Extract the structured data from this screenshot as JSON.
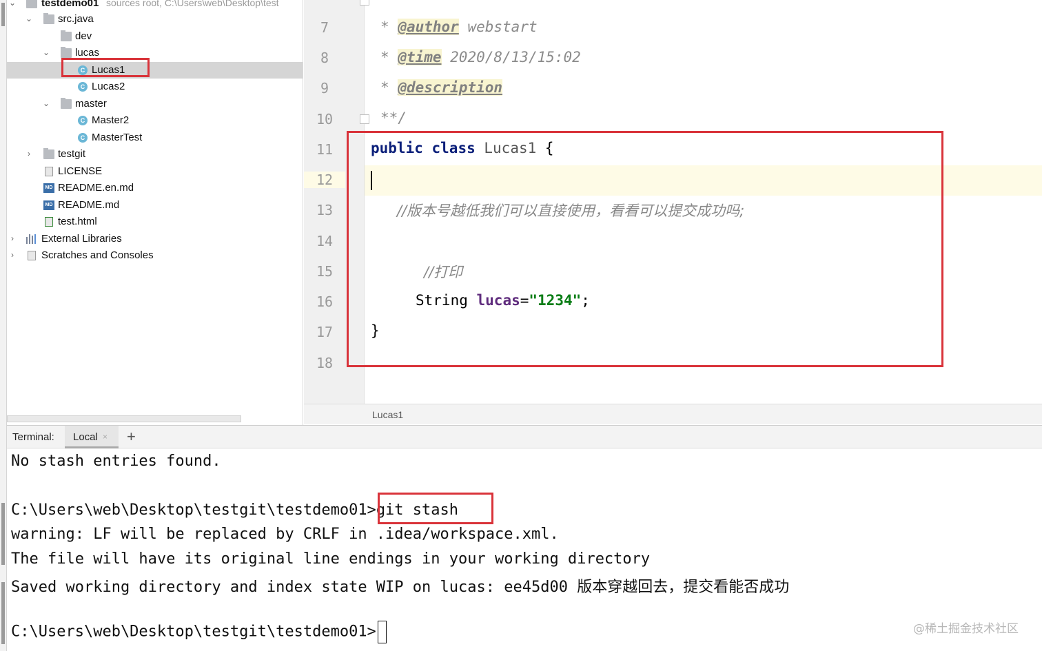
{
  "project_tree": {
    "root": {
      "name": "testdemo01",
      "path": "sources root,  C:\\Users\\web\\Desktop\\test"
    },
    "items": [
      {
        "label": "src.java"
      },
      {
        "label": "dev"
      },
      {
        "label": "lucas"
      },
      {
        "label": "Lucas1",
        "icon_letter": "C"
      },
      {
        "label": "Lucas2",
        "icon_letter": "C"
      },
      {
        "label": "master"
      },
      {
        "label": "Master2",
        "icon_letter": "C"
      },
      {
        "label": "MasterTest",
        "icon_letter": "C"
      },
      {
        "label": "testgit"
      },
      {
        "label": "LICENSE"
      },
      {
        "label": "README.en.md",
        "icon_text": "MD"
      },
      {
        "label": "README.md",
        "icon_text": "MD"
      },
      {
        "label": "test.html"
      },
      {
        "label": "External Libraries"
      },
      {
        "label": "Scratches and Consoles"
      }
    ],
    "selected": "Lucas1"
  },
  "editor": {
    "line_numbers": [
      "7",
      "8",
      "9",
      "10",
      "11",
      "12",
      "13",
      "14",
      "15",
      "16",
      "17",
      "18"
    ],
    "current_line": "12",
    "doc": {
      "author_prefix": "* ",
      "author_tag": "@author",
      "author_value": " webstart",
      "time_prefix": "* ",
      "time_tag": "@time",
      "time_value": " 2020/8/13/15:02",
      "desc_prefix": "* ",
      "desc_tag": "@description",
      "end": "**/"
    },
    "code": {
      "kw_public": "public",
      "kw_class": "class",
      "class_name": "Lucas1",
      "open_brace": "{",
      "comment1": "//版本号越低我们可以直接使用，看看可以提交成功吗;",
      "comment2": "//打印",
      "type": "String",
      "field": "lucas",
      "equals": "=",
      "string": "\"1234\"",
      "semicolon": ";",
      "close_brace": "}"
    },
    "breadcrumb": "Lucas1"
  },
  "terminal": {
    "label": "Terminal:",
    "tab": "Local",
    "close_glyph": "×",
    "add_glyph": "+",
    "lines": {
      "l1": "No stash entries found.",
      "prompt1": "C:\\Users\\web\\Desktop\\testgit\\testdemo01>",
      "cmd": "git stash",
      "l3": "warning: LF will be replaced by CRLF in .idea/workspace.xml.",
      "l4": "The file will have its original line endings in your working directory",
      "l5": "Saved working directory and index state WIP on lucas: ee45d00 版本穿越回去，提交看能否成功",
      "prompt2": "C:\\Users\\web\\Desktop\\testgit\\testdemo01>"
    }
  },
  "watermark": "@稀土掘金技术社区",
  "colors": {
    "highlight_red": "#d9333a",
    "keyword": "#0b1f7a",
    "string": "#0a7d16",
    "current_line": "#fefbe6"
  }
}
